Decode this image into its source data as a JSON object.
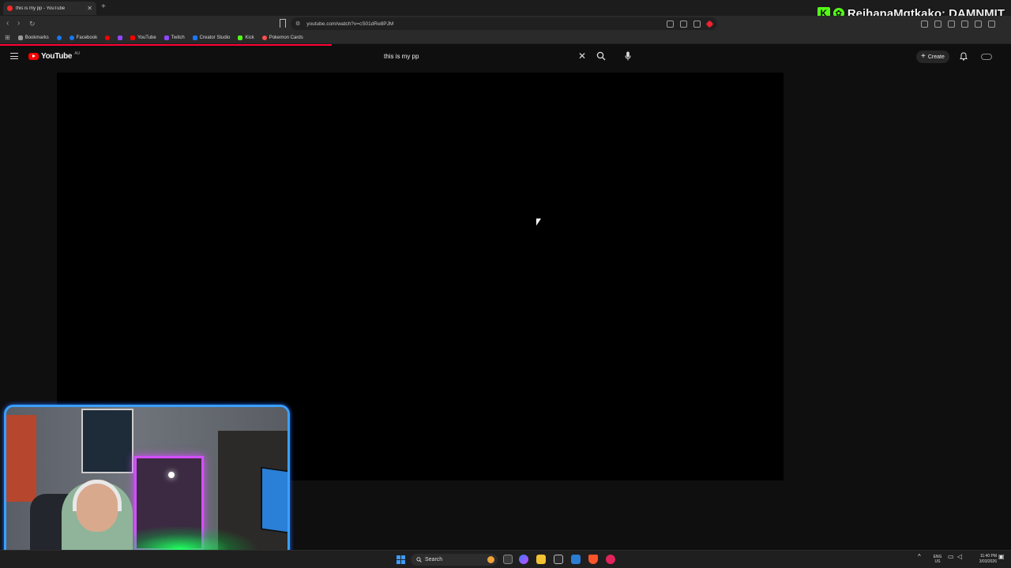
{
  "browser": {
    "tab": {
      "title": "this is my pp - YouTube"
    },
    "url": "youtube.com/watch?v=cS01dRe8PJM",
    "bookmarks": [
      {
        "label": "Bookmarks",
        "color": "#9a9a9a"
      },
      {
        "label": "",
        "color": "#1877f2"
      },
      {
        "label": "Facebook",
        "color": "#1877f2"
      },
      {
        "label": "",
        "color": "#ff0000"
      },
      {
        "label": "",
        "color": "#9146ff"
      },
      {
        "label": "YouTube",
        "color": "#ff0000"
      },
      {
        "label": "Twitch",
        "color": "#9146ff"
      },
      {
        "label": "Creator Studio",
        "color": "#1877f2"
      },
      {
        "label": "Kick",
        "color": "#53fc18"
      },
      {
        "label": "Pokemon Cards",
        "color": "#ff4d4d"
      }
    ]
  },
  "stream_overlay": {
    "name": "ReihanaMgtkako: DAMNMIT",
    "accent": "#53fc18"
  },
  "youtube": {
    "logo_text": "YouTube",
    "country": "AU",
    "search_value": "this is my pp",
    "create_label": "Create"
  },
  "taskbar": {
    "search_label": "Search",
    "lang_top": "ENG",
    "lang_bottom": "US",
    "time": "11:40 PM",
    "date": "3/03/2026"
  },
  "colors": {
    "youtube_red": "#ff0000",
    "webcam_border": "#3aa0ff"
  }
}
